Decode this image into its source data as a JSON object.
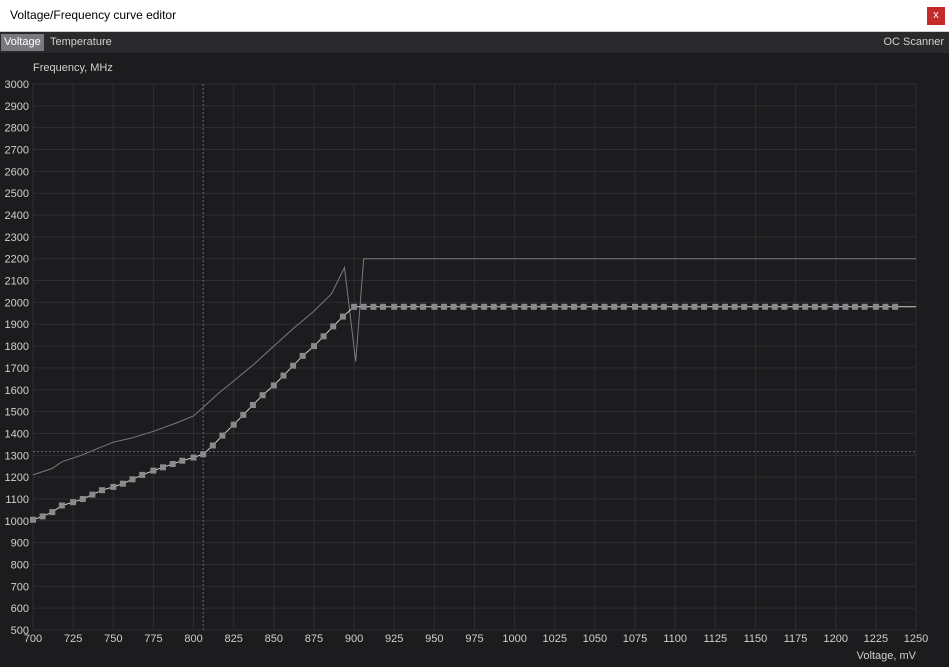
{
  "window": {
    "title": "Voltage/Frequency curve editor",
    "close_label": "x"
  },
  "tabs": [
    {
      "label": "Voltage",
      "active": true
    },
    {
      "label": "Temperature",
      "active": false
    }
  ],
  "oc_scanner_label": "OC Scanner",
  "colors": {
    "background": "#1c1c1e",
    "grid": "#2e2e31",
    "curve": "#7b7b7e",
    "marker": "#8a8a8d",
    "text": "#cfcfcf"
  },
  "chart_data": {
    "type": "line",
    "xlabel": "Voltage, mV",
    "ylabel": "Frequency, MHz",
    "xlim": [
      700,
      1250
    ],
    "ylim": [
      500,
      3000
    ],
    "x_ticks": [
      700,
      725,
      750,
      775,
      800,
      825,
      850,
      875,
      900,
      925,
      950,
      975,
      1000,
      1025,
      1050,
      1075,
      1100,
      1125,
      1150,
      1175,
      1200,
      1225,
      1250
    ],
    "y_ticks": [
      500,
      600,
      700,
      800,
      900,
      1000,
      1100,
      1200,
      1300,
      1400,
      1500,
      1600,
      1700,
      1800,
      1900,
      2000,
      2100,
      2200,
      2300,
      2400,
      2500,
      2600,
      2700,
      2800,
      2900,
      3000
    ],
    "grid": true,
    "crosshair": {
      "x": 806,
      "y": 1317
    },
    "series": [
      {
        "style": "line",
        "points": [
          [
            700,
            1210
          ],
          [
            712,
            1240
          ],
          [
            718,
            1270
          ],
          [
            730,
            1300
          ],
          [
            740,
            1330
          ],
          [
            750,
            1360
          ],
          [
            762,
            1380
          ],
          [
            775,
            1410
          ],
          [
            790,
            1450
          ],
          [
            800,
            1480
          ],
          [
            806,
            1520
          ],
          [
            815,
            1580
          ],
          [
            825,
            1640
          ],
          [
            838,
            1720
          ],
          [
            850,
            1800
          ],
          [
            862,
            1880
          ],
          [
            875,
            1960
          ],
          [
            886,
            2040
          ],
          [
            894,
            2160
          ],
          [
            901,
            1730
          ],
          [
            906,
            2200
          ],
          [
            1250,
            2200
          ]
        ]
      },
      {
        "style": "markers",
        "points": [
          [
            700,
            1005
          ],
          [
            706,
            1020
          ],
          [
            712,
            1040
          ],
          [
            718,
            1070
          ],
          [
            725,
            1085
          ],
          [
            731,
            1100
          ],
          [
            737,
            1120
          ],
          [
            743,
            1140
          ],
          [
            750,
            1155
          ],
          [
            756,
            1170
          ],
          [
            762,
            1190
          ],
          [
            768,
            1210
          ],
          [
            775,
            1230
          ],
          [
            781,
            1245
          ],
          [
            787,
            1260
          ],
          [
            793,
            1275
          ],
          [
            800,
            1290
          ],
          [
            806,
            1305
          ],
          [
            812,
            1345
          ],
          [
            818,
            1390
          ],
          [
            825,
            1440
          ],
          [
            831,
            1485
          ],
          [
            837,
            1530
          ],
          [
            843,
            1575
          ],
          [
            850,
            1620
          ],
          [
            856,
            1665
          ],
          [
            862,
            1710
          ],
          [
            868,
            1755
          ],
          [
            875,
            1800
          ],
          [
            881,
            1845
          ],
          [
            887,
            1890
          ],
          [
            893,
            1935
          ],
          [
            900,
            1980
          ],
          [
            906,
            1980
          ],
          [
            912,
            1980
          ],
          [
            918,
            1980
          ],
          [
            925,
            1980
          ],
          [
            931,
            1980
          ],
          [
            937,
            1980
          ],
          [
            943,
            1980
          ],
          [
            950,
            1980
          ],
          [
            956,
            1980
          ],
          [
            962,
            1980
          ],
          [
            968,
            1980
          ],
          [
            975,
            1980
          ],
          [
            981,
            1980
          ],
          [
            987,
            1980
          ],
          [
            993,
            1980
          ],
          [
            1000,
            1980
          ],
          [
            1006,
            1980
          ],
          [
            1012,
            1980
          ],
          [
            1018,
            1980
          ],
          [
            1025,
            1980
          ],
          [
            1031,
            1980
          ],
          [
            1037,
            1980
          ],
          [
            1043,
            1980
          ],
          [
            1050,
            1980
          ],
          [
            1056,
            1980
          ],
          [
            1062,
            1980
          ],
          [
            1068,
            1980
          ],
          [
            1075,
            1980
          ],
          [
            1081,
            1980
          ],
          [
            1087,
            1980
          ],
          [
            1093,
            1980
          ],
          [
            1100,
            1980
          ],
          [
            1106,
            1980
          ],
          [
            1112,
            1980
          ],
          [
            1118,
            1980
          ],
          [
            1125,
            1980
          ],
          [
            1131,
            1980
          ],
          [
            1137,
            1980
          ],
          [
            1143,
            1980
          ],
          [
            1150,
            1980
          ],
          [
            1156,
            1980
          ],
          [
            1162,
            1980
          ],
          [
            1168,
            1980
          ],
          [
            1175,
            1980
          ],
          [
            1181,
            1980
          ],
          [
            1187,
            1980
          ],
          [
            1193,
            1980
          ],
          [
            1200,
            1980
          ],
          [
            1206,
            1980
          ],
          [
            1212,
            1980
          ],
          [
            1218,
            1980
          ],
          [
            1225,
            1980
          ],
          [
            1231,
            1980
          ],
          [
            1237,
            1980
          ]
        ],
        "line_extends_to": 1250
      }
    ]
  }
}
